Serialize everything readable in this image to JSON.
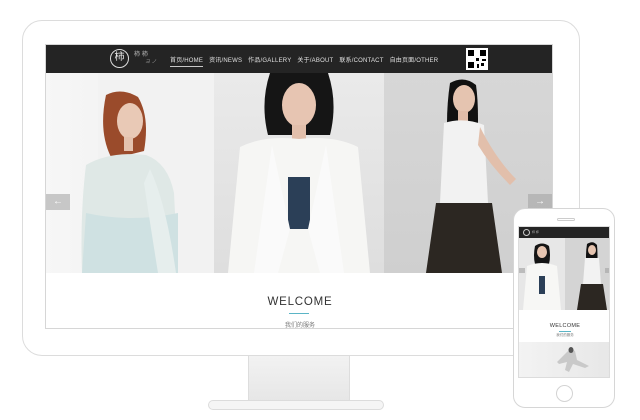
{
  "site": {
    "logo_mark": "柿",
    "logo_text_cn": "柿 柿",
    "logo_text_sub": "ヨ ノ"
  },
  "nav": {
    "items": [
      {
        "label": "首页/HOME",
        "active": true
      },
      {
        "label": "资讯/NEWS",
        "active": false
      },
      {
        "label": "作品/GALLERY",
        "active": false
      },
      {
        "label": "关于/ABOUT",
        "active": false
      },
      {
        "label": "联系/CONTACT",
        "active": false
      },
      {
        "label": "自由页面/OTHER",
        "active": false
      }
    ]
  },
  "qr_icon": "qr-code-icon",
  "banner": {
    "prev_icon": "←",
    "next_icon": "→",
    "slides": 3,
    "active_slide": 1
  },
  "welcome": {
    "title": "WELCOME",
    "subtitle": "我们的服务"
  },
  "colors": {
    "navbar": "#242424",
    "accent": "#5bb5c6",
    "device_outline": "#dcdcdc"
  }
}
